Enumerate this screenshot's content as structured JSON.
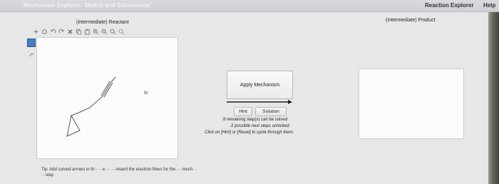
{
  "header": {
    "title": "Mechanism Explorer: Sketch and Submission",
    "menu": [
      "Reaction Explorer",
      "Help"
    ]
  },
  "reactant_panel": {
    "title": "(Intermediate) Reactant",
    "toolbar_icons": [
      "plus-dropdown-icon",
      "ring-icon",
      "undo-icon",
      "redo-icon",
      "delete-x-icon",
      "copy-icon",
      "paste-icon",
      "zoom-in-icon",
      "zoom-out-icon",
      "zoom-fit-icon",
      "zoom-reset-icon"
    ],
    "side_tool_icons": [
      "arrow-tool-icon",
      "curved-arrow-tool-icon"
    ],
    "atom_label": "Br",
    "tip": "Tip: Add curved arrows in th··· ··e ··· ···resent the electron flows for the ··· mech··· ···step"
  },
  "center": {
    "apply_label": "Apply Mechanism",
    "hint_label": "Hint",
    "solution_label": "Solution",
    "status_remaining": "8 remaining step(s) can be solved",
    "status_possible": "2 possible next steps unlocked",
    "status_instruction": "Click on [Hint] or [Reset] to cycle through them."
  },
  "product_panel": {
    "title": "(Intermediate) Product"
  },
  "colors": {
    "titlebar": "#d4d5db",
    "accent": "#4a7bbd",
    "canvas": "#fbfbfb"
  }
}
